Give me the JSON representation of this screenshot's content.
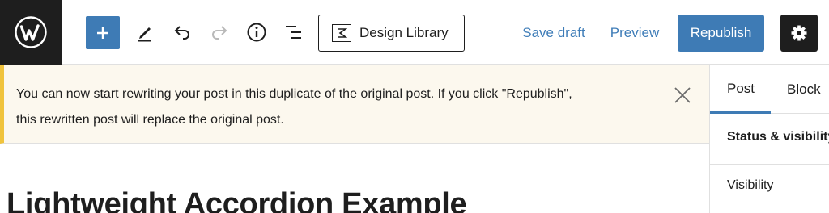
{
  "toolbar": {
    "design_library_label": "Design Library",
    "save_draft_label": "Save draft",
    "preview_label": "Preview",
    "republish_label": "Republish",
    "icons": [
      "wordpress-logo",
      "plus-icon",
      "pen-icon",
      "undo-icon",
      "redo-icon",
      "info-icon",
      "list-view-icon",
      "design-library-icon",
      "gear-icon"
    ]
  },
  "notice": {
    "text": "You can now start rewriting your post in this duplicate of the original post. If you click \"Republish\",\nthis rewritten post will replace the original post."
  },
  "editor": {
    "title": "Lightweight Accordion Example"
  },
  "sidebar": {
    "tabs": [
      {
        "label": "Post"
      },
      {
        "label": "Block"
      }
    ],
    "panel_title": "Status & visibility",
    "visibility_label": "Visibility"
  },
  "colors": {
    "accent": "#3e7bb5",
    "link": "#3f7db8",
    "dark": "#1e1e1e",
    "notice_bg": "#fcf8ee",
    "notice_border": "#f0c33c"
  }
}
